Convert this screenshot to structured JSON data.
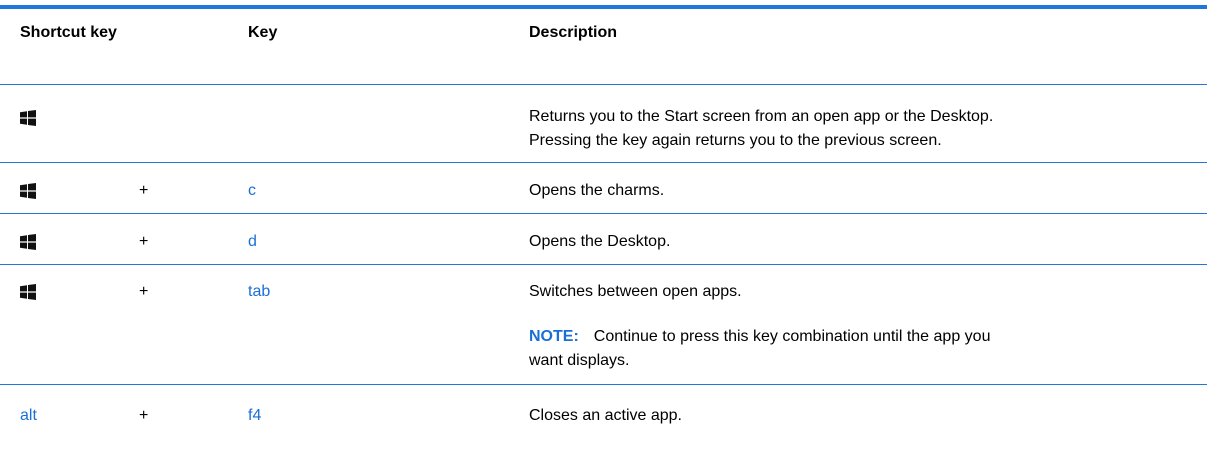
{
  "table": {
    "headers": {
      "shortcut_key": "Shortcut key",
      "key": "Key",
      "description": "Description"
    },
    "rows": [
      {
        "shortcut_icon": "windows-key-icon",
        "plus": "",
        "key": "",
        "description_line1": "Returns you to the Start screen from an open app or the Desktop.",
        "description_line2": "Pressing the key again returns you to the previous screen."
      },
      {
        "shortcut_icon": "windows-key-icon",
        "plus": "+",
        "key": "c",
        "description_line1": "Opens the charms."
      },
      {
        "shortcut_icon": "windows-key-icon",
        "plus": "+",
        "key": "d",
        "description_line1": "Opens the Desktop."
      },
      {
        "shortcut_icon": "windows-key-icon",
        "plus": "+",
        "key": "tab",
        "description_line1": "Switches between open apps.",
        "note_label": "NOTE:",
        "note_line1": "Continue to press this key combination until the app you",
        "note_line2": "want displays."
      },
      {
        "shortcut": "alt",
        "plus": "+",
        "key": "f4",
        "description_line1": "Closes an active app."
      }
    ]
  },
  "colors": {
    "rule": "#1f77d9",
    "link_text": "#1a6fd6"
  }
}
